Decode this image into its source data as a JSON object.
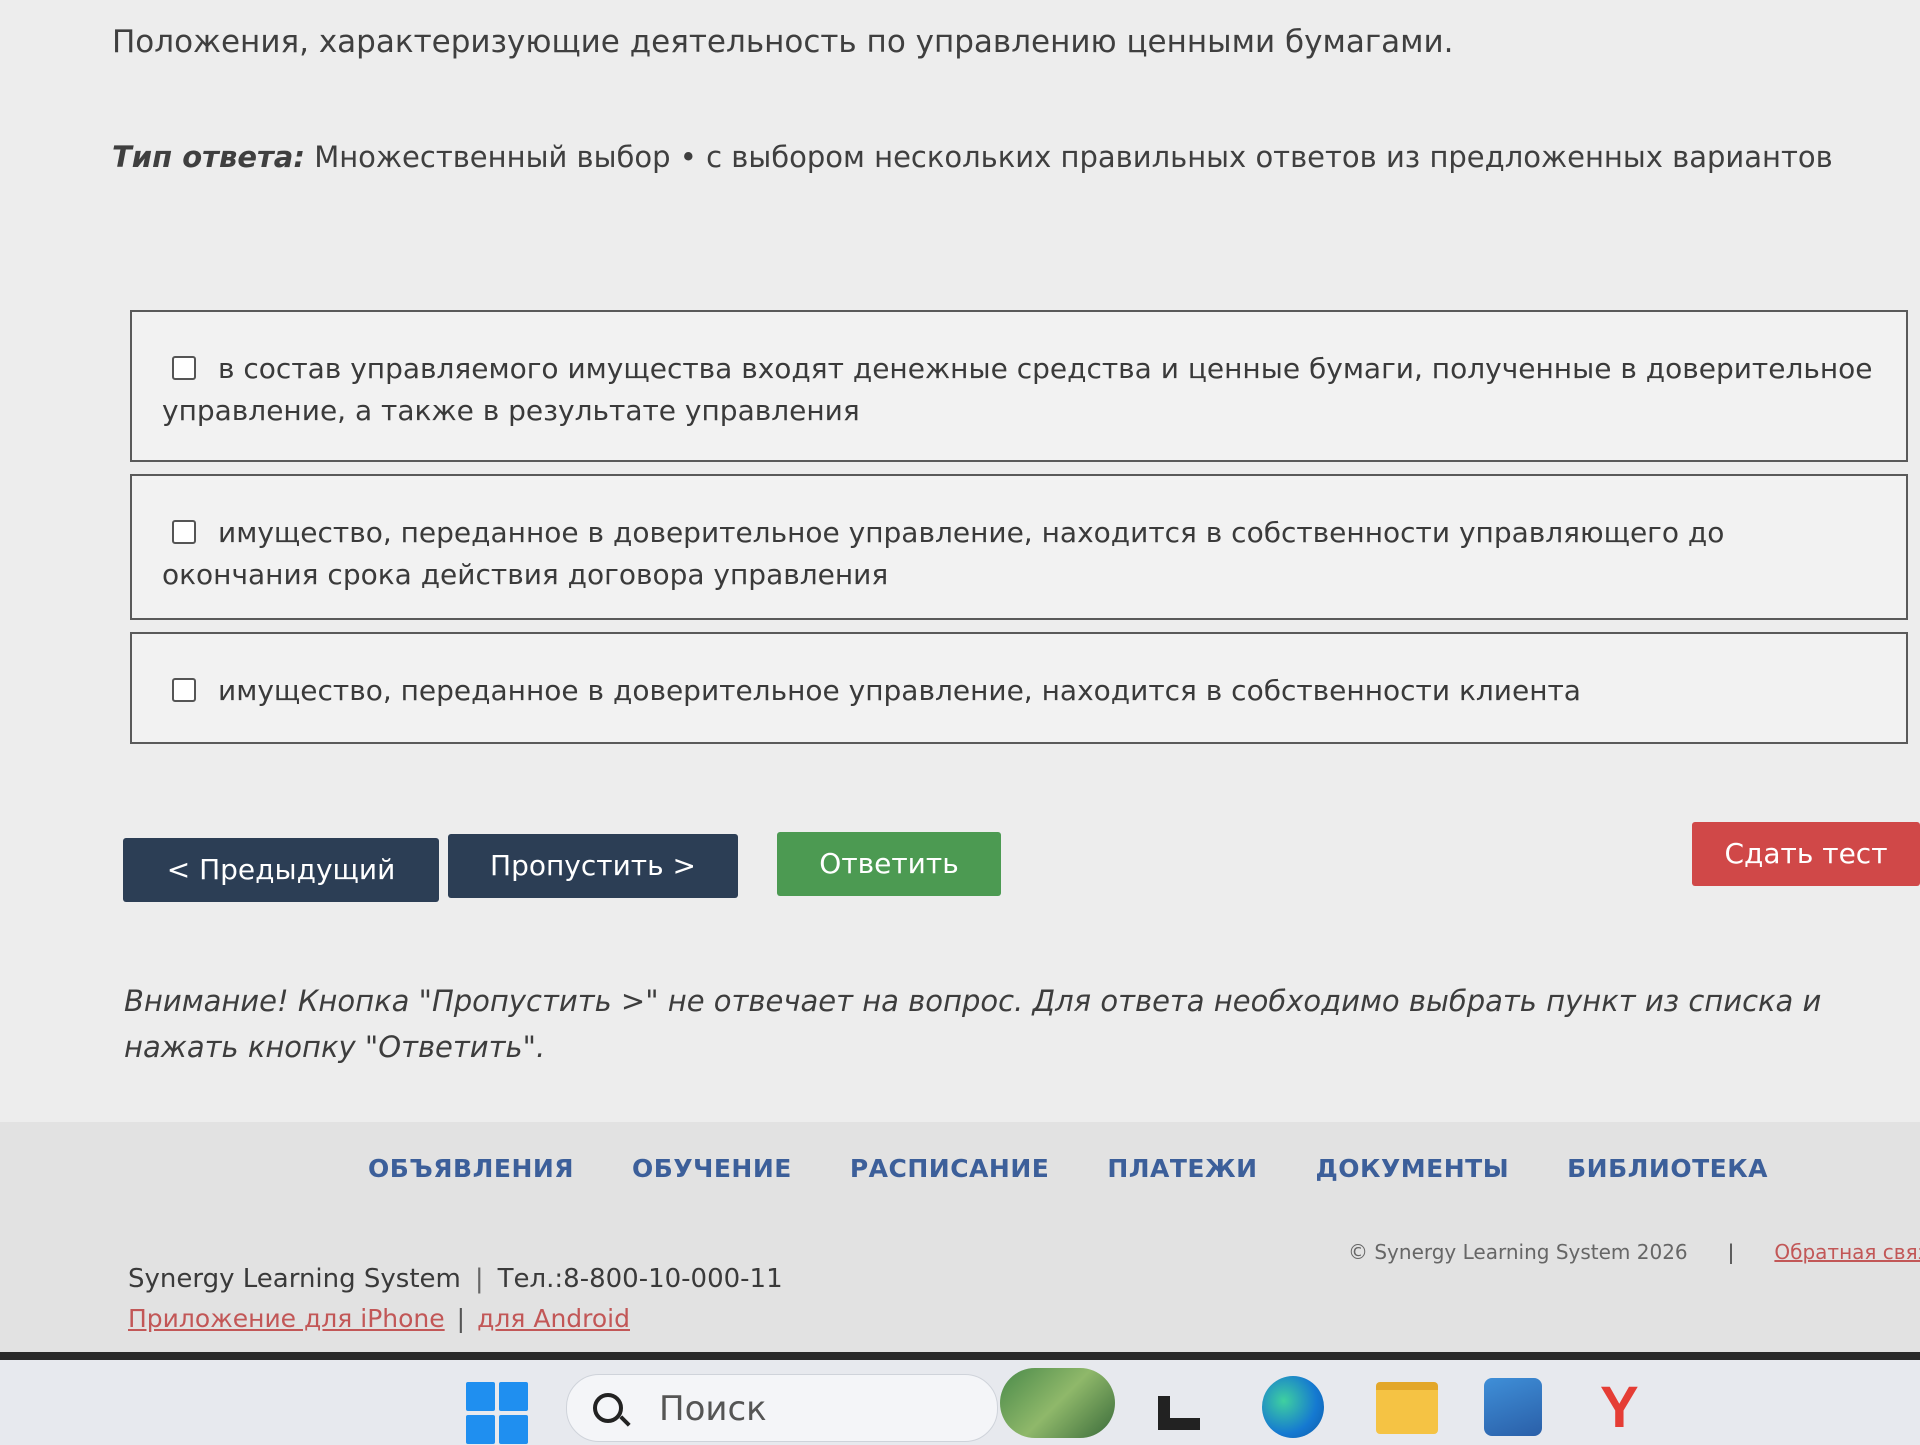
{
  "question": {
    "text": "Положения, характеризующие деятельность по управлению ценными бумагами.",
    "answer_type_label": "Тип ответа:",
    "answer_type_value": "Множественный выбор • с выбором нескольких правильных ответов из предложенных вариантов"
  },
  "options": [
    {
      "text": "в состав управляемого имущества входят денежные средства и ценные бумаги, полученные в доверительное управление, а также в результате управления",
      "checked": false
    },
    {
      "text": "имущество, переданное в доверительное управление, находится в собственности управляющего до окончания срока действия договора управления",
      "checked": false
    },
    {
      "text": "имущество, переданное в доверительное управление, находится в собственности клиента",
      "checked": false
    }
  ],
  "buttons": {
    "previous": "< Предыдущий",
    "skip": "Пропустить >",
    "answer": "Ответить",
    "submit": "Сдать тест"
  },
  "warning": "Внимание! Кнопка \"Пропустить >\" не отвечает на вопрос. Для ответа необходимо выбрать пункт из списка и нажать кнопку \"Ответить\".",
  "footer": {
    "nav": [
      "ОБЪЯВЛЕНИЯ",
      "ОБУЧЕНИЕ",
      "РАСПИСАНИЕ",
      "ПЛАТЕЖИ",
      "ДОКУМЕНТЫ",
      "БИБЛИОТЕКА"
    ],
    "brand": "Synergy Learning System",
    "separator": "|",
    "phone": "Тел.:8-800-10-000-11",
    "app_iphone": "Приложение для iPhone",
    "app_android": "для Android",
    "copyright": "© Synergy Learning System 2026",
    "feedback": "Обратная связь"
  },
  "taskbar": {
    "search_placeholder": "Поиск",
    "yandex_glyph": "Y",
    "icons": [
      "windows-start-icon",
      "search-icon",
      "widgets-icon",
      "task-view-icon",
      "edge-icon",
      "file-explorer-icon",
      "store-icon",
      "yandex-browser-icon"
    ]
  },
  "colors": {
    "nav_button": "#2c3e55",
    "answer_button": "#4c9a52",
    "submit_button": "#d04848",
    "footer_link": "#3c5f9a",
    "app_link": "#c25757"
  }
}
